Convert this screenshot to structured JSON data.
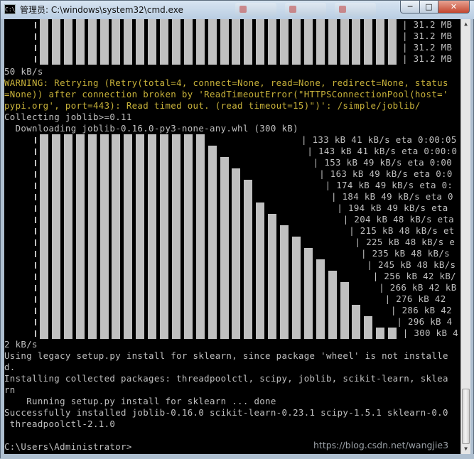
{
  "window": {
    "title": "管理员: C:\\windows\\system32\\cmd.exe",
    "icon": "cmd-icon",
    "buttons": {
      "minimize": "─",
      "maximize": "□",
      "close": "✕"
    }
  },
  "console": {
    "top_progress_sizes": [
      "| 31.2 MB",
      "| 31.2 MB",
      "| 31.2 MB",
      "| 31.2 MB"
    ],
    "line_speed1": "50 kB/s",
    "warning_lines": [
      "WARNING: Retrying (Retry(total=4, connect=None, read=None, redirect=None, status",
      "=None)) after connection broken by 'ReadTimeoutError(\"HTTPSConnectionPool(host='",
      "pypi.org', port=443): Read timed out. (read timeout=15)\")': /simple/joblib/"
    ],
    "collecting": "Collecting joblib>=0.11",
    "downloading": "  Downloading joblib-0.16.0-py3-none-any.whl (300 kB)",
    "download_progress": [
      "| 133 kB 41 kB/s eta 0:00:05",
      "| 143 kB 41 kB/s eta 0:00:0",
      "| 153 kB 49 kB/s eta 0:00",
      "| 163 kB 49 kB/s eta 0:0",
      "| 174 kB 49 kB/s eta 0:",
      "| 184 kB 49 kB/s eta 0",
      "| 194 kB 49 kB/s eta",
      "| 204 kB 48 kB/s eta",
      "| 215 kB 48 kB/s et",
      "| 225 kB 48 kB/s e",
      "| 235 kB 48 kB/s",
      "| 245 kB 48 kB/s",
      "| 256 kB 42 kB/",
      "| 266 kB 42 kB",
      "| 276 kB 42",
      "| 286 kB 42",
      "| 296 kB 4",
      "| 300 kB 4"
    ],
    "line_speed2": "2 kB/s",
    "legacy_lines": [
      "Using legacy setup.py install for sklearn, since package 'wheel' is not installe",
      "d."
    ],
    "installing_lines": [
      "Installing collected packages: threadpoolctl, scipy, joblib, scikit-learn, sklea",
      "rn"
    ],
    "running": "    Running setup.py install for sklearn ... done",
    "success_lines": [
      "Successfully installed joblib-0.16.0 scikit-learn-0.23.1 scipy-1.5.1 sklearn-0.0",
      " threadpoolctl-2.1.0"
    ],
    "prompt": "C:\\Users\\Administrator>"
  },
  "watermark": "https://blog.csdn.net/wangjie3"
}
